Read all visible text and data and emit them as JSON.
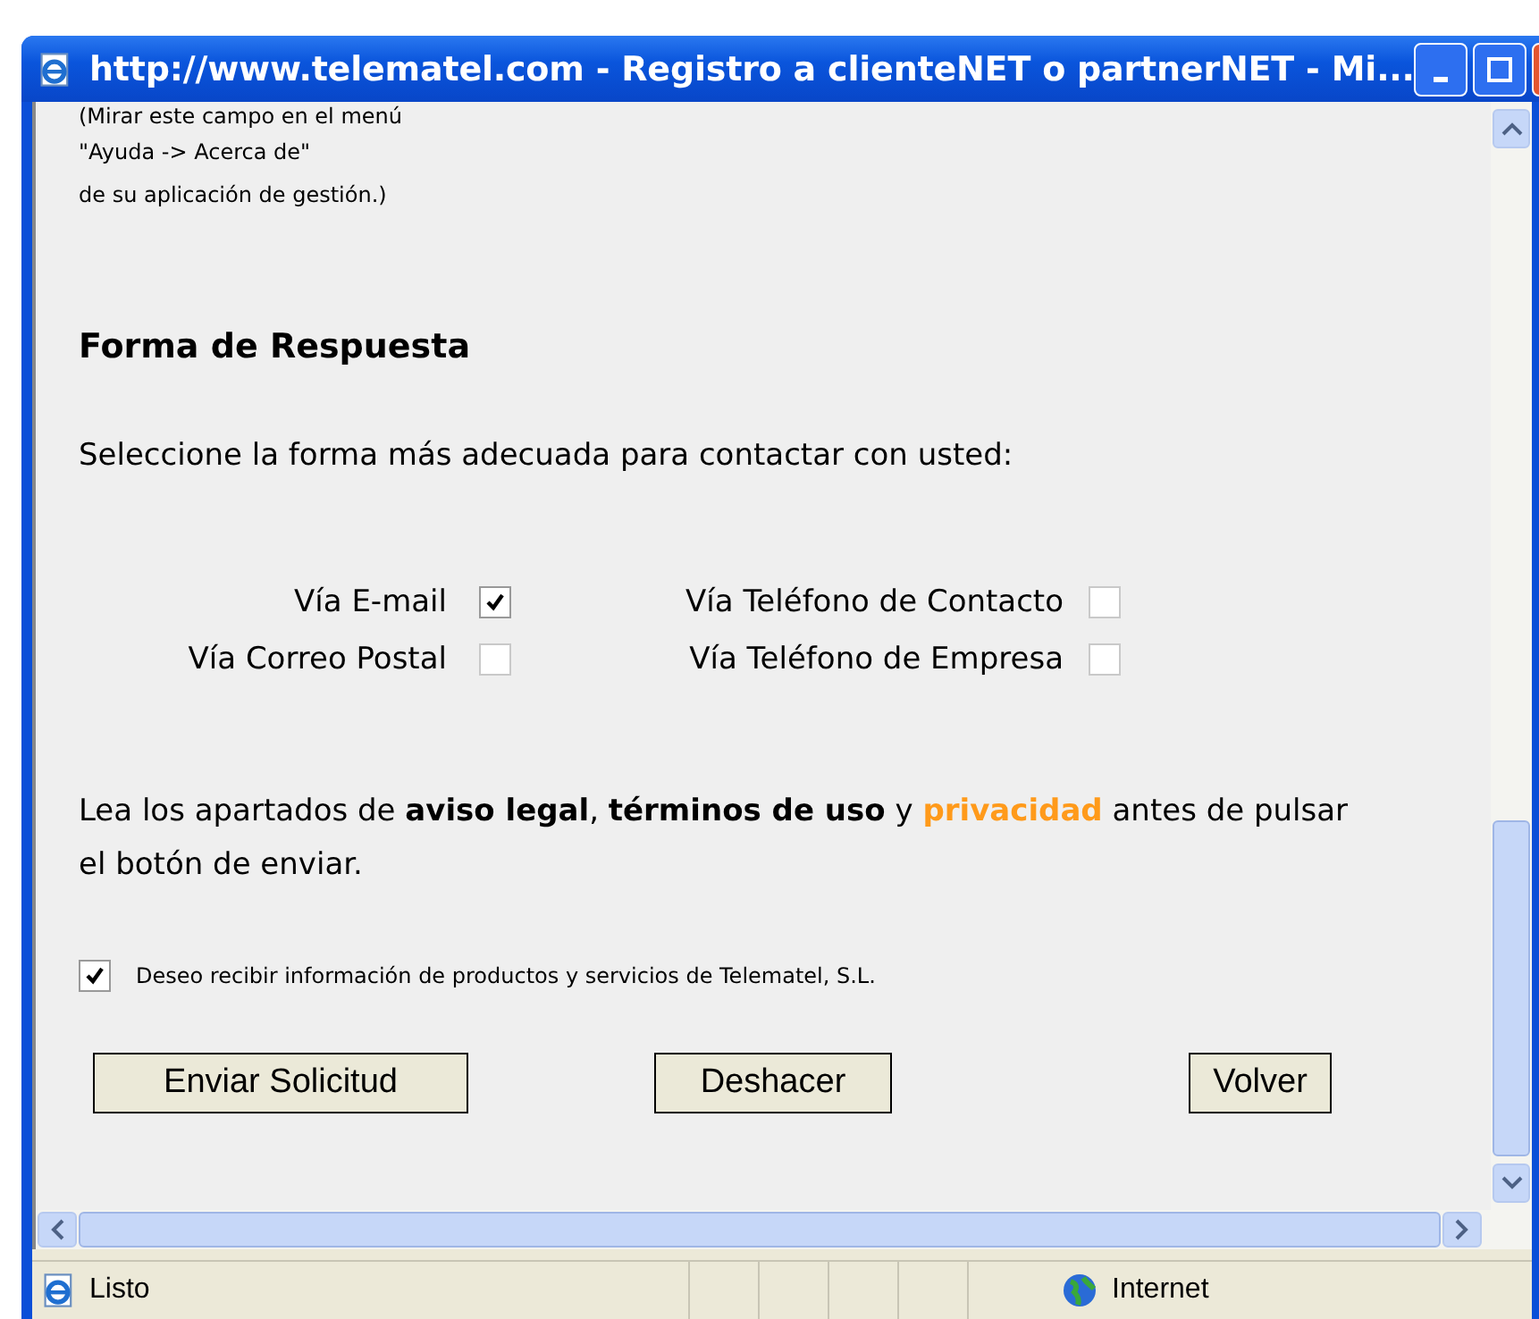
{
  "window": {
    "title": "http://www.telematel.com - Registro a clienteNET o partnerNET - Mi..."
  },
  "intro_lines": [
    "(Mirar este campo en el menú",
    "\"Ayuda -> Acerca de\"",
    "de su aplicación de gestión.)"
  ],
  "section": {
    "heading": "Forma de Respuesta",
    "prompt": "Seleccione la forma más adecuada para contactar con usted:"
  },
  "contact_options": [
    {
      "label": "Vía E-mail",
      "checked": true
    },
    {
      "label": "Vía Teléfono de Contacto",
      "checked": false
    },
    {
      "label": "Vía Correo Postal",
      "checked": false
    },
    {
      "label": "Vía Teléfono de Empresa",
      "checked": false
    }
  ],
  "legal_notice": {
    "before": "Lea los apartados de **aviso legal**, **términos de uso** y",
    "link": "privacidad",
    "after": "antes de pulsar el botón de enviar."
  },
  "newsletter": {
    "label": "Deseo recibir información de productos y servicios de Telematel, S.L.",
    "checked": true
  },
  "buttons": [
    "Enviar Solicitud",
    "Deshacer",
    "Volver"
  ],
  "status_bar": {
    "text": "Listo",
    "zone": "Internet"
  }
}
